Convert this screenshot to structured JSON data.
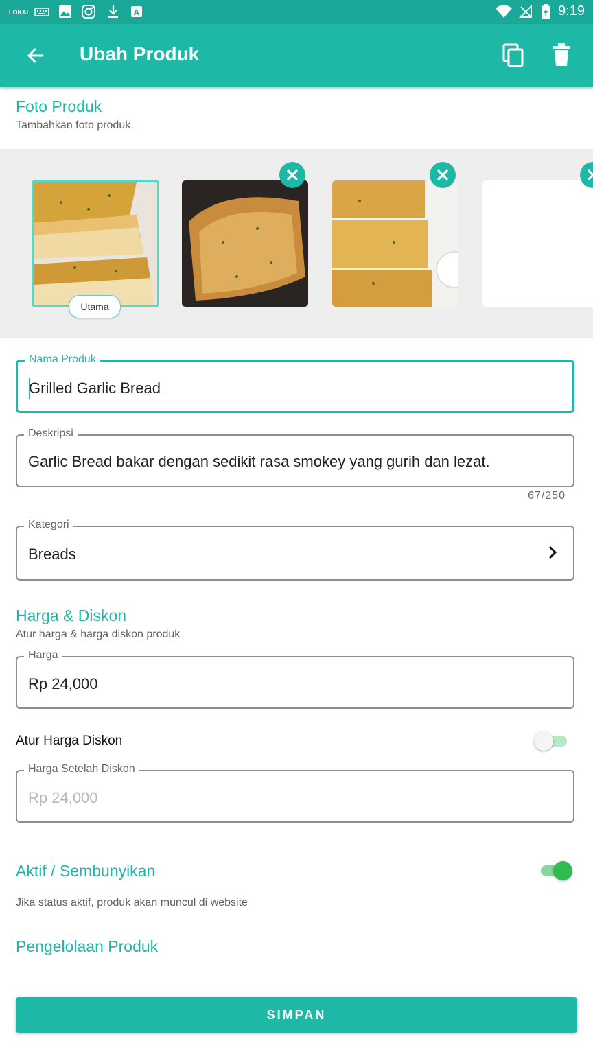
{
  "status_bar": {
    "carrier_logo": "LOKAL",
    "time": "9:19",
    "icons": [
      "keyboard-icon",
      "image-icon",
      "instagram-icon",
      "download-icon",
      "text-icon",
      "wifi-icon",
      "no-signal-icon",
      "battery-charging-icon"
    ]
  },
  "app_bar": {
    "title": "Ubah Produk",
    "icons": [
      "back-arrow-icon",
      "copy-icon",
      "delete-icon"
    ]
  },
  "photo_section": {
    "title": "Foto Produk",
    "subtitle": "Tambahkan foto produk.",
    "main_badge": "Utama"
  },
  "fields": {
    "name": {
      "label": "Nama Produk",
      "value": "Grilled Garlic Bread"
    },
    "description": {
      "label": "Deskripsi",
      "value": "Garlic Bread bakar dengan sedikit rasa smokey yang gurih dan lezat.",
      "counter": "67/250"
    },
    "category": {
      "label": "Kategori",
      "value": "Breads"
    }
  },
  "pricing": {
    "title": "Harga & Diskon",
    "subtitle": "Atur harga & harga diskon produk",
    "price": {
      "label": "Harga",
      "value": "Rp 24,000"
    },
    "discount_toggle": {
      "label": "Atur Harga Diskon",
      "on": false
    },
    "discount_price": {
      "label": "Harga Setelah Diskon",
      "value": "Rp 24,000"
    }
  },
  "active_section": {
    "title": "Aktif / Sembunyikan",
    "subtitle": "Jika status aktif, produk akan muncul di website",
    "on": true
  },
  "management": {
    "title": "Pengelolaan Produk"
  },
  "save_button": {
    "label": "SIMPAN"
  },
  "colors": {
    "primary": "#1db9a6",
    "status_bar": "#1aa898",
    "toggle_on": "#2ebd4e"
  }
}
